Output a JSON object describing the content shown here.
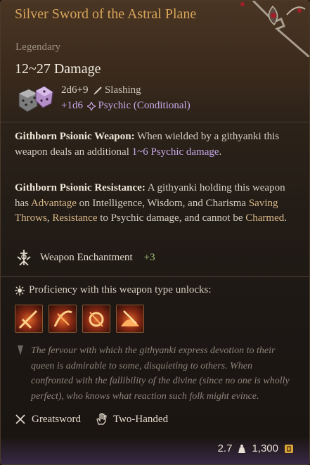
{
  "item": {
    "title": "Silver Sword of the Astral Plane",
    "rarity": "Legendary",
    "damage": "12~27 Damage",
    "base_dice": "2d6+9",
    "base_type": "Slashing",
    "extra_dice": "+1d6",
    "extra_type": "Psychic (Conditional)"
  },
  "passives": [
    {
      "name": "Githborn Psionic Weapon:",
      "text_a": " When wielded by a githyanki this weapon deals an additional ",
      "hl": "1~6 Psychic damage",
      "text_b": "."
    },
    {
      "name": "Githborn Psionic Resistance:",
      "text_a": " A githyanki holding this weapon has ",
      "hl1": "Advantage",
      "text_b": " on Intelligence, Wisdom, and Charisma ",
      "hl2": "Saving Throws",
      "text_c": ", ",
      "hl3": "Resistance",
      "text_d": " to Psychic damage, and cannot be ",
      "hl4": "Charmed",
      "text_e": "."
    }
  ],
  "enchantment": {
    "label": "Weapon Enchantment",
    "value": "+3"
  },
  "proficiency": {
    "label": "Proficiency with this weapon type unlocks:"
  },
  "lore": "The fervour with which the githyanki express devotion to their queen is admirable to some, disquieting to others. When confronted with the fallibility of the divine (since no one is wholly perfect), who knows what reaction such folk might evince.",
  "tags": {
    "type": "Greatsword",
    "handed": "Two-Handed"
  },
  "footer": {
    "weight": "2.7",
    "price": "1,300"
  },
  "colors": {
    "title": "#d7a45a",
    "psychic": "#c7a8e8",
    "highlight": "#d9b88a",
    "bonus": "#a8c27a"
  }
}
